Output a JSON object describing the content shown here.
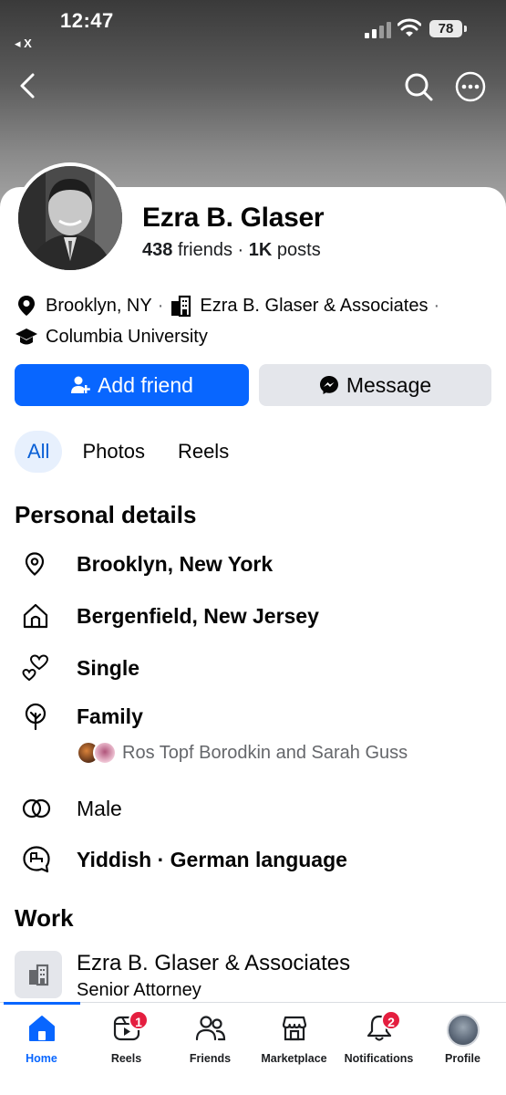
{
  "status_bar": {
    "time": "12:47",
    "back_app": "◂ X",
    "battery": "78"
  },
  "profile": {
    "name": "Ezra B. Glaser",
    "friends_count": "438",
    "friends_label": "friends",
    "posts_count": "1K",
    "posts_label": "posts"
  },
  "intro": {
    "location": "Brooklyn, NY",
    "workplace": "Ezra B. Glaser & Associates",
    "school": "Columbia University"
  },
  "actions": {
    "add_friend": "Add friend",
    "message": "Message"
  },
  "tabs": [
    {
      "label": "All",
      "active": true
    },
    {
      "label": "Photos",
      "active": false
    },
    {
      "label": "Reels",
      "active": false
    }
  ],
  "personal_details": {
    "title": "Personal details",
    "items": [
      {
        "icon": "location-pin-icon",
        "text": "Brooklyn, New York"
      },
      {
        "icon": "home-icon",
        "text": "Bergenfield, New Jersey"
      },
      {
        "icon": "hearts-icon",
        "text": "Single"
      },
      {
        "icon": "family-tree-icon",
        "text": "Family"
      },
      {
        "icon": "gender-icon",
        "text": "Male"
      },
      {
        "icon": "language-icon",
        "text": "Yiddish · German language"
      }
    ],
    "family_members": "Ros Topf Borodkin and Sarah Guss"
  },
  "work": {
    "title": "Work",
    "company": "Ezra B. Glaser & Associates",
    "role": "Senior Attorney"
  },
  "tabbar": [
    {
      "label": "Home",
      "icon": "home-icon",
      "active": true
    },
    {
      "label": "Reels",
      "icon": "reels-icon",
      "badge": "1"
    },
    {
      "label": "Friends",
      "icon": "friends-icon"
    },
    {
      "label": "Marketplace",
      "icon": "marketplace-icon"
    },
    {
      "label": "Notifications",
      "icon": "bell-icon",
      "badge": "2"
    },
    {
      "label": "Profile",
      "icon": "profile-avatar"
    }
  ],
  "colors": {
    "accent": "#0866ff",
    "badge": "#e41e3f",
    "secondary_button": "#e4e6eb",
    "active_tab_bg": "#e7f0fd"
  }
}
